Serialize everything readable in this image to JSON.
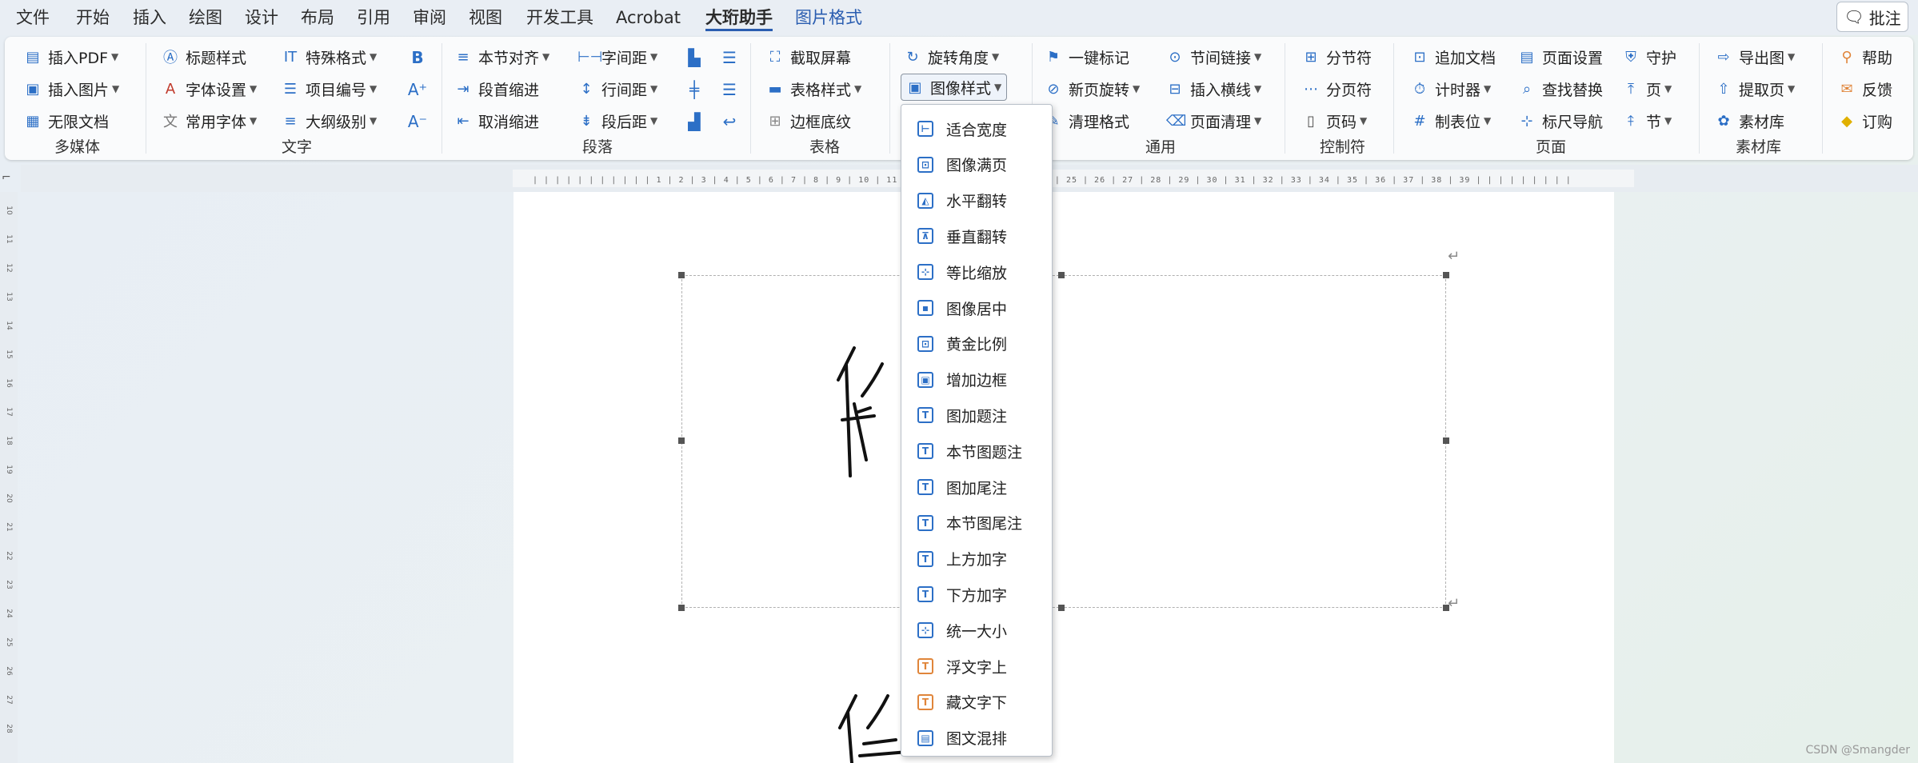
{
  "menubar": {
    "tabs": [
      "文件",
      "开始",
      "插入",
      "绘图",
      "设计",
      "布局",
      "引用",
      "审阅",
      "视图",
      "开发工具",
      "Acrobat",
      "大珩助手",
      "图片格式"
    ],
    "active_tab": "大珩助手",
    "comment_label": "批注"
  },
  "ribbon": {
    "groups": [
      "多媒体",
      "文字",
      "段落",
      "表格",
      "通用",
      "控制符",
      "页面",
      "素材库"
    ],
    "multimedia": [
      "插入PDF",
      "插入图片",
      "无限文档"
    ],
    "text": [
      "标题样式",
      "特殊格式",
      "字体设置",
      "项目编号",
      "常用字体",
      "大纲级别"
    ],
    "paragraph": [
      "本节对齐",
      "字间距",
      "段首缩进",
      "行间距",
      "取消缩进",
      "段后距"
    ],
    "table": [
      "截取屏幕",
      "表格样式",
      "边框底纹"
    ],
    "image": [
      "旋转角度",
      "图像样式"
    ],
    "general": [
      "一键标记",
      "节间链接",
      "新页旋转",
      "插入横线",
      "清理格式",
      "页面清理"
    ],
    "control": [
      "分节符",
      "分页符",
      "页码"
    ],
    "page": [
      "追加文档",
      "页面设置",
      "守护",
      "计时器",
      "查找替换",
      "页",
      "制表位",
      "标尺导航",
      "节"
    ],
    "materials": [
      "导出图",
      "提取页",
      "素材库"
    ],
    "help": [
      "帮助",
      "反馈",
      "订购"
    ]
  },
  "ruler": {
    "ticks": "| | | | | | | | | | | 1 | 2 | 3 | 4 | 5 | 6 | 7 | 8 | 9 | 10 | 11 |                                           | 20 | 21 | 22 | 23 | 24 | 25 | 26 | 27 | 28 | 29 | 30 | 31 | 32 | 33 | 34 | 35 | 36 | 37 | 38 | 39 |     | | | | | | | |",
    "vertical": [
      "10",
      "11",
      "12",
      "13",
      "14",
      "15",
      "16",
      "17",
      "18",
      "19",
      "20",
      "21",
      "22",
      "23",
      "24",
      "25",
      "26",
      "27",
      "28"
    ]
  },
  "dropdown": {
    "items": [
      "适合宽度",
      "图像满页",
      "水平翻转",
      "垂直翻转",
      "等比缩放",
      "图像居中",
      "黄金比例",
      "增加边框",
      "图加题注",
      "本节图题注",
      "图加尾注",
      "本节图尾注",
      "上方加字",
      "下方加字",
      "统一大小",
      "浮文字上",
      "藏文字下",
      "图文混排"
    ]
  },
  "watermark": "CSDN @Smangder",
  "colors": {
    "accent": "#2a5db0",
    "icon_blue": "#2c6fc6",
    "icon_orange": "#e0853a"
  }
}
